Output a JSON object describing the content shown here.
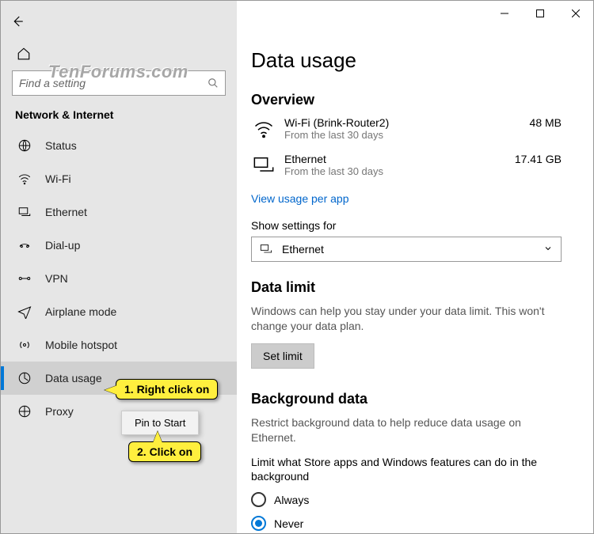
{
  "watermark": "TenForums.com",
  "titlebar": {
    "min_tip": "Minimize",
    "max_tip": "Maximize",
    "close_tip": "Close"
  },
  "sidebar": {
    "search_placeholder": "Find a setting",
    "section_heading": "Network & Internet",
    "items": [
      {
        "icon": "globe-icon",
        "label": "Status"
      },
      {
        "icon": "wifi-icon",
        "label": "Wi-Fi"
      },
      {
        "icon": "ethernet-icon",
        "label": "Ethernet"
      },
      {
        "icon": "dialup-icon",
        "label": "Dial-up"
      },
      {
        "icon": "vpn-icon",
        "label": "VPN"
      },
      {
        "icon": "airplane-icon",
        "label": "Airplane mode"
      },
      {
        "icon": "hotspot-icon",
        "label": "Mobile hotspot"
      },
      {
        "icon": "data-icon",
        "label": "Data usage",
        "active": true
      },
      {
        "icon": "proxy-icon",
        "label": "Proxy"
      }
    ]
  },
  "context_menu": {
    "items": [
      {
        "label": "Pin to Start"
      }
    ]
  },
  "annotations": {
    "step1": "1. Right click on",
    "step2": "2. Click on"
  },
  "content": {
    "title": "Data usage",
    "overview": {
      "heading": "Overview",
      "rows": [
        {
          "icon": "wifi-icon",
          "name": "Wi-Fi (Brink-Router2)",
          "sub": "From the last 30 days",
          "value": "48 MB"
        },
        {
          "icon": "ethernet-icon",
          "name": "Ethernet",
          "sub": "From the last 30 days",
          "value": "17.41 GB"
        }
      ],
      "link": "View usage per app"
    },
    "settings_for": {
      "label": "Show settings for",
      "value": "Ethernet"
    },
    "data_limit": {
      "heading": "Data limit",
      "desc": "Windows can help you stay under your data limit. This won't change your data plan.",
      "button": "Set limit"
    },
    "background": {
      "heading": "Background data",
      "desc": "Restrict background data to help reduce data usage on Ethernet.",
      "subhead": "Limit what Store apps and Windows features can do in the background",
      "options": [
        "Always",
        "Never"
      ],
      "selected": "Never"
    }
  }
}
